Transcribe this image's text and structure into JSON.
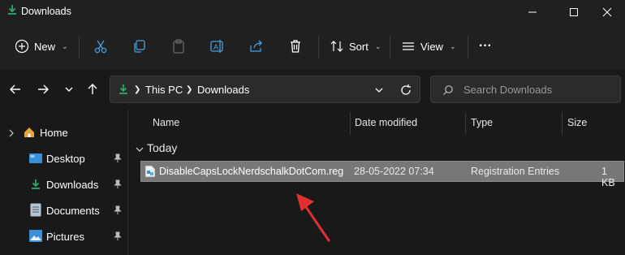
{
  "window": {
    "title": "Downloads"
  },
  "toolbar": {
    "new_label": "New",
    "sort_label": "Sort",
    "view_label": "View",
    "more_label": "···"
  },
  "address": {
    "crumbs": [
      "This PC",
      "Downloads"
    ]
  },
  "search": {
    "placeholder": "Search Downloads"
  },
  "sidebar": {
    "items": [
      {
        "label": "Home",
        "icon": "home-icon"
      },
      {
        "label": "Desktop",
        "icon": "desktop-folder-icon"
      },
      {
        "label": "Downloads",
        "icon": "download-icon"
      },
      {
        "label": "Documents",
        "icon": "documents-icon"
      },
      {
        "label": "Pictures",
        "icon": "pictures-icon"
      }
    ]
  },
  "columns": {
    "name": "Name",
    "date": "Date modified",
    "type": "Type",
    "size": "Size"
  },
  "group": {
    "label": "Today"
  },
  "files": [
    {
      "name": "DisableCapsLockNerdschalkDotCom.reg",
      "date": "28-05-2022 07:34",
      "type": "Registration Entries",
      "size": "1 KB"
    }
  ],
  "colors": {
    "accent": "#2fa86b",
    "selection": "#777777",
    "arrow": "#e03030"
  }
}
